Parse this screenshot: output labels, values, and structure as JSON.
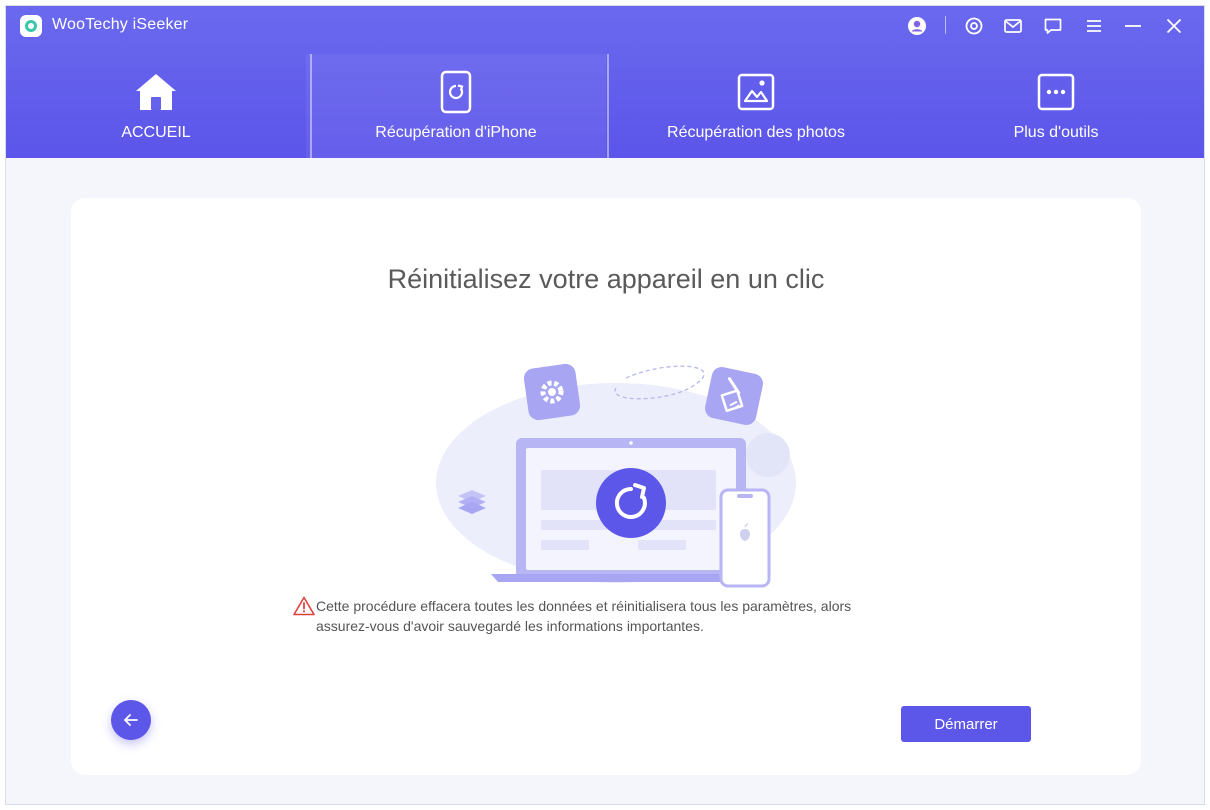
{
  "app": {
    "title": "WooTechy iSeeker"
  },
  "titlebar": {
    "icons": [
      "user-avatar-icon",
      "settings-target-icon",
      "mail-icon",
      "chat-icon",
      "menu-icon",
      "minimize-icon",
      "close-icon"
    ]
  },
  "tabs": [
    {
      "label": "ACCUEIL",
      "icon": "home-icon",
      "active": false
    },
    {
      "label": "Récupération d'iPhone",
      "icon": "phone-refresh-icon",
      "active": true
    },
    {
      "label": "Récupération des photos",
      "icon": "photo-icon",
      "active": false
    },
    {
      "label": "Plus d'outils",
      "icon": "more-tools-icon",
      "active": false
    }
  ],
  "main": {
    "title": "Réinitialisez votre appareil en un clic",
    "warning_line1": "Cette procédure effacera toutes les données et réinitialisera tous les paramètres, alors",
    "warning_line2": "assurez-vous d'avoir sauvegardé les informations importantes.",
    "start_label": "Démarrer"
  },
  "colors": {
    "header": "#5c55ea",
    "accent": "#5d57e9",
    "warning": "#e0413a",
    "illustration_light": "#eceefb",
    "illustration_mid": "#a8a6f3"
  }
}
